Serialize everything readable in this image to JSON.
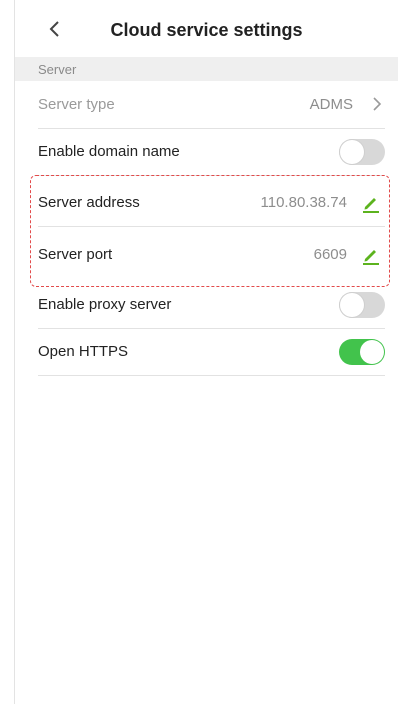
{
  "header": {
    "title": "Cloud service settings"
  },
  "section": {
    "label": "Server"
  },
  "rows": {
    "server_type": {
      "label": "Server type",
      "value": "ADMS"
    },
    "enable_domain": {
      "label": "Enable domain name",
      "enabled": false
    },
    "server_address": {
      "label": "Server address",
      "value": "110.80.38.74"
    },
    "server_port": {
      "label": "Server port",
      "value": "6609"
    },
    "enable_proxy": {
      "label": "Enable proxy server",
      "enabled": false
    },
    "open_https": {
      "label": "Open HTTPS",
      "enabled": true
    }
  },
  "colors": {
    "accent_green": "#42c34c",
    "edit_icon": "#5cb31e",
    "highlight_border": "#e24a4a"
  },
  "icons": {
    "back": "chevron-left-icon",
    "forward": "chevron-right-icon",
    "edit": "pencil-icon"
  }
}
